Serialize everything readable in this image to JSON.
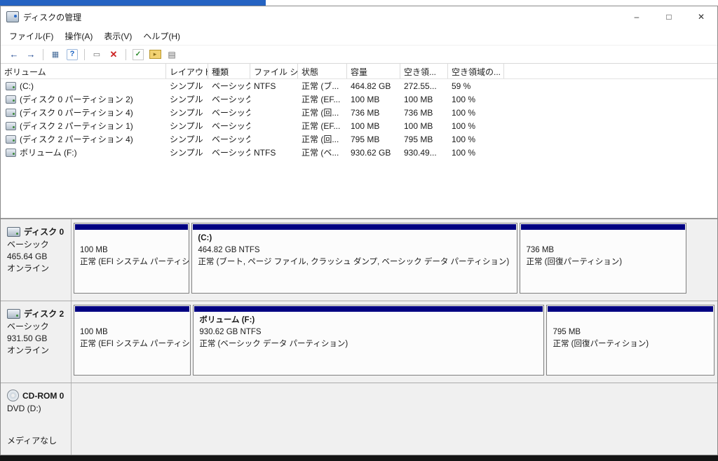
{
  "window": {
    "title": "ディスクの管理",
    "controls": {
      "minimize": "–",
      "maximize": "□",
      "close": "✕"
    }
  },
  "menu": {
    "items": [
      {
        "label": "ファイル(F)"
      },
      {
        "label": "操作(A)"
      },
      {
        "label": "表示(V)"
      },
      {
        "label": "ヘルプ(H)"
      }
    ]
  },
  "toolbar": {
    "icons": [
      {
        "name": "back-icon",
        "glyph": "←"
      },
      {
        "name": "forward-icon",
        "glyph": "→"
      },
      {
        "name": "console-tree-icon",
        "glyph": "▦"
      },
      {
        "name": "help-icon",
        "glyph": "?"
      },
      {
        "name": "action-dialog-icon",
        "glyph": "▭"
      },
      {
        "name": "delete-volume-icon",
        "glyph": "✕"
      },
      {
        "name": "mark-active-icon",
        "glyph": "✓"
      },
      {
        "name": "open-folder-icon",
        "glyph": "▸"
      },
      {
        "name": "properties-icon",
        "glyph": "▤"
      }
    ]
  },
  "volume_list": {
    "columns": [
      "ボリューム",
      "レイアウト",
      "種類",
      "ファイル シ...",
      "状態",
      "容量",
      "空き領...",
      "空き領域の..."
    ],
    "rows": [
      {
        "volume": "(C:)",
        "layout": "シンプル",
        "type": "ベーシック",
        "fs": "NTFS",
        "status": "正常 (ブ...",
        "capacity": "464.82 GB",
        "free": "272.55...",
        "free_pct": "59 %"
      },
      {
        "volume": "(ディスク 0 パーティション 2)",
        "layout": "シンプル",
        "type": "ベーシック",
        "fs": "",
        "status": "正常 (EF...",
        "capacity": "100 MB",
        "free": "100 MB",
        "free_pct": "100 %"
      },
      {
        "volume": "(ディスク 0 パーティション 4)",
        "layout": "シンプル",
        "type": "ベーシック",
        "fs": "",
        "status": "正常 (回...",
        "capacity": "736 MB",
        "free": "736 MB",
        "free_pct": "100 %"
      },
      {
        "volume": "(ディスク 2 パーティション 1)",
        "layout": "シンプル",
        "type": "ベーシック",
        "fs": "",
        "status": "正常 (EF...",
        "capacity": "100 MB",
        "free": "100 MB",
        "free_pct": "100 %"
      },
      {
        "volume": "(ディスク 2 パーティション 4)",
        "layout": "シンプル",
        "type": "ベーシック",
        "fs": "",
        "status": "正常 (回...",
        "capacity": "795 MB",
        "free": "795 MB",
        "free_pct": "100 %"
      },
      {
        "volume": "ボリューム (F:)",
        "layout": "シンプル",
        "type": "ベーシック",
        "fs": "NTFS",
        "status": "正常 (ベ...",
        "capacity": "930.62 GB",
        "free": "930.49...",
        "free_pct": "100 %"
      }
    ]
  },
  "disks": [
    {
      "name": "ディスク 0",
      "type": "ベーシック",
      "size": "465.64 GB",
      "status": "オンライン",
      "partitions": [
        {
          "title": "",
          "size": "100 MB",
          "status": "正常 (EFI システム パーティショ"
        },
        {
          "title": "(C:)",
          "size": "464.82 GB NTFS",
          "status": "正常 (ブート, ページ ファイル, クラッシュ ダンプ, ベーシック データ パーティション)"
        },
        {
          "title": "",
          "size": "736 MB",
          "status": "正常 (回復パーティション)"
        }
      ]
    },
    {
      "name": "ディスク 2",
      "type": "ベーシック",
      "size": "931.50 GB",
      "status": "オンライン",
      "partitions": [
        {
          "title": "",
          "size": "100 MB",
          "status": "正常 (EFI システム パーティショ"
        },
        {
          "title": "ボリューム  (F:)",
          "size": "930.62 GB NTFS",
          "status": "正常 (ベーシック データ パーティション)"
        },
        {
          "title": "",
          "size": "795 MB",
          "status": "正常 (回復パーティション)"
        }
      ]
    }
  ],
  "cdrom": {
    "name": "CD-ROM 0",
    "drive": "DVD (D:)",
    "media": "メディアなし"
  },
  "colors": {
    "partition_bar": "#000082",
    "panel_bg": "#f0f0f0",
    "top_strip_blue": "#2563c2",
    "bottom_strip_black": "#141414"
  }
}
